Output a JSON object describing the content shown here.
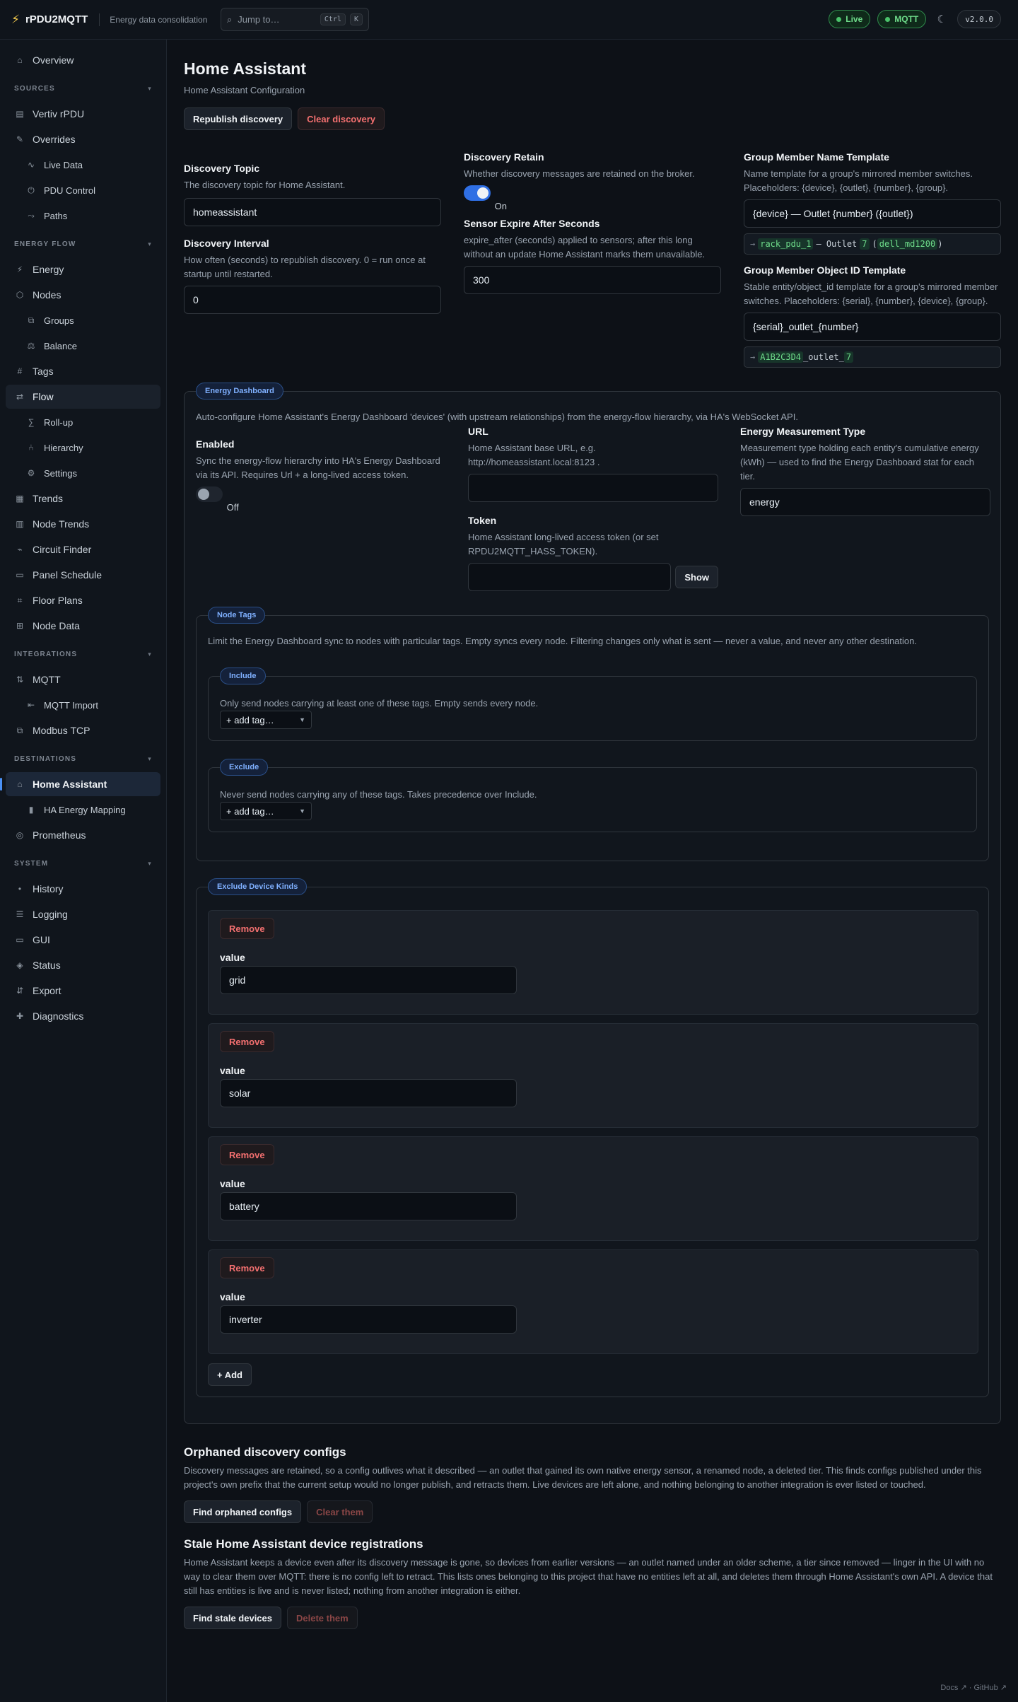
{
  "header": {
    "app_name": "rPDU2MQTT",
    "app_subtitle": "Energy data consolidation",
    "jump_placeholder": "Jump to…",
    "kbd_ctrl": "Ctrl",
    "kbd_k": "K",
    "live_label": "Live",
    "mqtt_label": "MQTT",
    "version": "v2.0.0"
  },
  "sidebar": {
    "overview": "Overview",
    "sections": {
      "sources": "SOURCES",
      "energy_flow": "ENERGY FLOW",
      "integrations": "INTEGRATIONS",
      "destinations": "DESTINATIONS",
      "system": "SYSTEM"
    },
    "items": {
      "vertiv": "Vertiv rPDU",
      "overrides": "Overrides",
      "live_data": "Live Data",
      "pdu_control": "PDU Control",
      "paths": "Paths",
      "energy": "Energy",
      "nodes": "Nodes",
      "groups": "Groups",
      "balance": "Balance",
      "tags": "Tags",
      "flow": "Flow",
      "rollup": "Roll-up",
      "hierarchy": "Hierarchy",
      "settings": "Settings",
      "trends": "Trends",
      "node_trends": "Node Trends",
      "circuit_finder": "Circuit Finder",
      "panel_schedule": "Panel Schedule",
      "floor_plans": "Floor Plans",
      "node_data": "Node Data",
      "mqtt": "MQTT",
      "mqtt_import": "MQTT Import",
      "modbus": "Modbus TCP",
      "home_assistant": "Home Assistant",
      "ha_energy_mapping": "HA Energy Mapping",
      "prometheus": "Prometheus",
      "history": "History",
      "logging": "Logging",
      "gui": "GUI",
      "status": "Status",
      "export": "Export",
      "diagnostics": "Diagnostics"
    }
  },
  "page": {
    "title": "Home Assistant",
    "subtitle": "Home Assistant Configuration",
    "republish_label": "Republish discovery",
    "clear_label": "Clear discovery"
  },
  "settings": {
    "discovery_topic": {
      "label": "Discovery Topic",
      "help": "The discovery topic for Home Assistant.",
      "value": "homeassistant"
    },
    "discovery_interval": {
      "label": "Discovery Interval",
      "help": "How often (seconds) to republish discovery. 0 = run once at startup until restarted.",
      "value": "0"
    },
    "discovery_retain": {
      "label": "Discovery Retain",
      "help": "Whether discovery messages are retained on the broker.",
      "state": "On"
    },
    "sensor_expire": {
      "label": "Sensor Expire After Seconds",
      "help": "expire_after (seconds) applied to sensors; after this long without an update Home Assistant marks them unavailable.",
      "value": "300"
    },
    "group_member_name": {
      "label": "Group Member Name Template",
      "help": "Name template for a group's mirrored member switches. Placeholders: {device}, {outlet}, {number}, {group}.",
      "value": "{device} — Outlet {number} ({outlet})",
      "preview_arrow": "→",
      "preview_device": "rack_pdu_1",
      "preview_mid": "— Outlet",
      "preview_number": "7",
      "preview_open": "(",
      "preview_outlet": "dell_md1200",
      "preview_close": ")"
    },
    "group_member_object": {
      "label": "Group Member Object ID Template",
      "help": "Stable entity/object_id template for a group's mirrored member switches. Placeholders: {serial}, {number}, {device}, {group}.",
      "value": "{serial}_outlet_{number}",
      "preview_arrow": "→",
      "preview_serial": "A1B2C3D4",
      "preview_mid": "_outlet_",
      "preview_number": "7"
    }
  },
  "energy_dashboard": {
    "legend": "Energy Dashboard",
    "description": "Auto-configure Home Assistant's Energy Dashboard 'devices' (with upstream relationships) from the energy-flow hierarchy, via HA's WebSocket API.",
    "enabled": {
      "label": "Enabled",
      "help": "Sync the energy-flow hierarchy into HA's Energy Dashboard via its API. Requires Url + a long-lived access token.",
      "state": "Off"
    },
    "url": {
      "label": "URL",
      "help": "Home Assistant base URL, e.g. http://homeassistant.local:8123 .",
      "value": ""
    },
    "token": {
      "label": "Token",
      "help": "Home Assistant long-lived access token (or set RPDU2MQTT_HASS_TOKEN).",
      "value": "",
      "show_label": "Show"
    },
    "measurement": {
      "label": "Energy Measurement Type",
      "help": "Measurement type holding each entity's cumulative energy (kWh) — used to find the Energy Dashboard stat for each tier.",
      "value": "energy"
    },
    "node_tags": {
      "legend": "Node Tags",
      "description": "Limit the Energy Dashboard sync to nodes with particular tags. Empty syncs every node. Filtering changes only what is sent — never a value, and never any other destination.",
      "include": {
        "legend": "Include",
        "description": "Only send nodes carrying at least one of these tags. Empty sends every node.",
        "select": "+ add tag…"
      },
      "exclude": {
        "legend": "Exclude",
        "description": "Never send nodes carrying any of these tags. Takes precedence over Include.",
        "select": "+ add tag…"
      }
    },
    "exclude_kinds": {
      "legend": "Exclude Device Kinds",
      "remove_label": "Remove",
      "value_label": "value",
      "items": [
        "grid",
        "solar",
        "battery",
        "inverter"
      ],
      "add_label": "+ Add"
    }
  },
  "orphaned": {
    "title": "Orphaned discovery configs",
    "description": "Discovery messages are retained, so a config outlives what it described — an outlet that gained its own native energy sensor, a renamed node, a deleted tier. This finds configs published under this project's own prefix that the current setup would no longer publish, and retracts them. Live devices are left alone, and nothing belonging to another integration is ever listed or touched.",
    "find_label": "Find orphaned configs",
    "clear_label": "Clear them"
  },
  "stale": {
    "title": "Stale Home Assistant device registrations",
    "description": "Home Assistant keeps a device even after its discovery message is gone, so devices from earlier versions — an outlet named under an older scheme, a tier since removed — linger in the UI with no way to clear them over MQTT: there is no config left to retract. This lists ones belonging to this project that have no entities left at all, and deletes them through Home Assistant's own API. A device that still has entities is live and is never listed; nothing from another integration is either.",
    "find_label": "Find stale devices",
    "delete_label": "Delete them"
  },
  "footer": {
    "links": "Docs ↗ · GitHub ↗"
  }
}
